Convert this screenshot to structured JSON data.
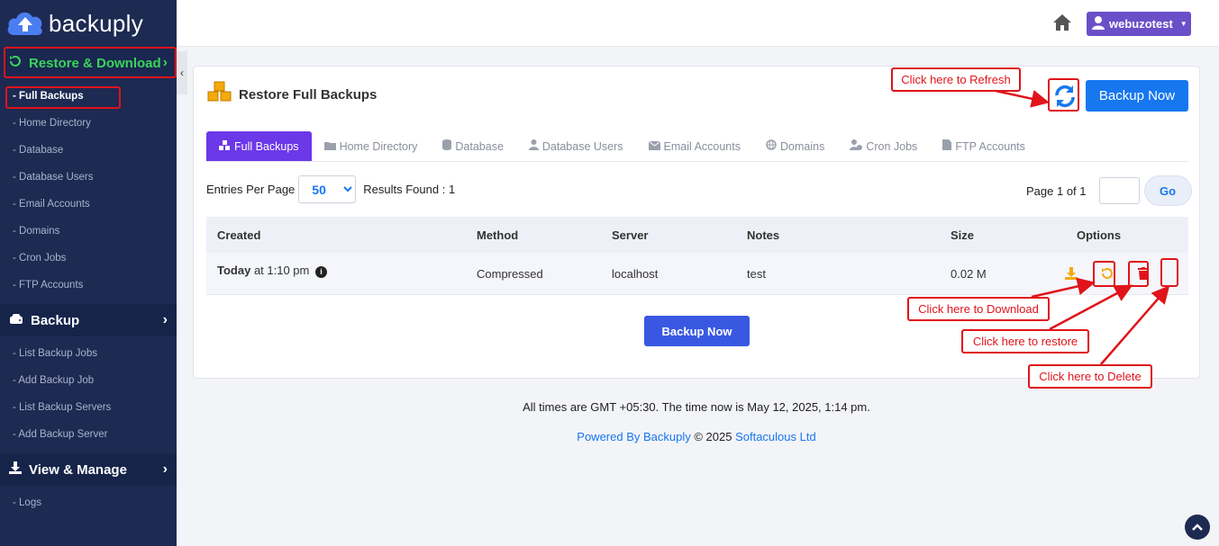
{
  "app": {
    "brand": "backuply"
  },
  "colors": {
    "sidebar": "#1d2a52",
    "accent_green": "#3ad45b",
    "primary": "#1677ef",
    "tab_active": "#6c38e8",
    "annotation": "#e0141a",
    "user_btn": "#6b4fc8"
  },
  "sidebar": {
    "restore": {
      "label": "Restore & Download",
      "items": [
        "- Full Backups",
        "- Home Directory",
        "- Database",
        "- Database Users",
        "- Email Accounts",
        "- Domains",
        "- Cron Jobs",
        "- FTP Accounts"
      ]
    },
    "backup": {
      "label": "Backup",
      "items": [
        "- List Backup Jobs",
        "- Add Backup Job",
        "- List Backup Servers",
        "- Add Backup Server"
      ]
    },
    "manage": {
      "label": "View & Manage",
      "items": [
        "- Logs"
      ]
    }
  },
  "header": {
    "user": "webuzotest"
  },
  "card": {
    "title": "Restore Full Backups",
    "backup_now": "Backup Now",
    "tabs": [
      "Full Backups",
      "Home Directory",
      "Database",
      "Database Users",
      "Email Accounts",
      "Domains",
      "Cron Jobs",
      "FTP Accounts"
    ],
    "entries_label": "Entries Per Page",
    "entries_value": "50",
    "results": "Results Found : 1",
    "page_label": "Page 1 of 1",
    "go": "Go",
    "table": {
      "headers": [
        "Created",
        "Method",
        "Server",
        "Notes",
        "Size",
        "Options"
      ],
      "row": {
        "created_bold": "Today",
        "created_rest": " at 1:10 pm",
        "method": "Compressed",
        "server": "localhost",
        "notes": "test",
        "size": "0.02 M"
      }
    },
    "backup_now_bottom": "Backup Now"
  },
  "footer": {
    "time": "All times are GMT +05:30. The time now is May 12, 2025, 1:14 pm.",
    "powered_prefix": "Powered By Backuply",
    "powered_mid": " © 2025 ",
    "powered_company": "Softaculous Ltd"
  },
  "annotations": {
    "refresh": "Click here to Refresh",
    "download": "Click here to Download",
    "restore": "Click here to restore",
    "delete": "Click here to Delete"
  }
}
